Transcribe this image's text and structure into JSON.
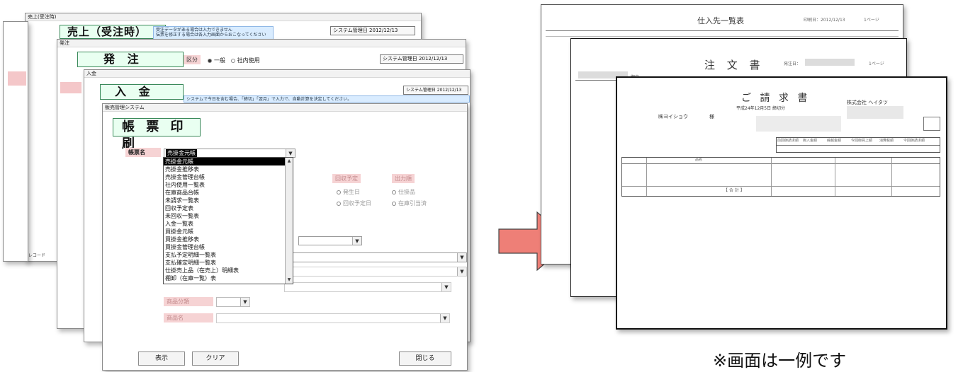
{
  "windows": {
    "sales": {
      "title": "売上(受注時)",
      "heading": "売上（受注時）",
      "note_line1": "受注データがある場合は入力できません",
      "note_line2": "伝票を修正する場合は各入力画面からおこなってください",
      "system_date_label": "システム管理日",
      "system_date": "2012/12/13",
      "footer": "レコード"
    },
    "order": {
      "title": "発注",
      "heading": "発 注",
      "kubun_label": "区分",
      "radio_ippan": "一般",
      "radio_shanai": "社内使用",
      "system_date_label": "システム管理日",
      "system_date": "2012/12/13"
    },
    "payment": {
      "title": "入金",
      "heading": "入 金",
      "system_date_label": "システム管理日",
      "system_date": "2012/12/13",
      "note": "システムで今日を含む場合、「締切」「翌月」で入力で、自動計算を決定してください。"
    },
    "report": {
      "title": "販売管理システム",
      "heading": "帳 票 印 刷",
      "report_name_label": "帳票名",
      "selected_value": "売掛金元帳",
      "list_items": [
        "売掛金元帳",
        "売掛金推移表",
        "売掛金管理台帳",
        "社内使用一覧表",
        "在庫商品台帳",
        "未請求一覧表",
        "回収予定表",
        "未回収一覧表",
        "入金一覧表",
        "買掛金元帳",
        "買掛金推移表",
        "買掛金管理台帳",
        "支払予定明細一覧表",
        "支払確定明細一覧表",
        "仕掛売上品（在売上）明細表",
        "棚卸（在庫一覧）表"
      ],
      "group1_label": "回収予定",
      "group1_opt1": "発生日",
      "group1_opt2": "回収予定日",
      "group2_label": "出力順",
      "group2_opt1": "仕掛品",
      "group2_opt2": "在庫引当済",
      "category_label": "商品分類",
      "product_label": "商品名",
      "btn_display": "表示",
      "btn_clear": "クリア",
      "btn_close": "閉じる"
    }
  },
  "documents": {
    "supplier_list": {
      "title": "仕入先一覧表",
      "print_date": "印刷日：2012/12/13",
      "page": "1ページ"
    },
    "purchase_order": {
      "title": "注 文 書",
      "order_date_label": "発注日：",
      "page": "1ページ",
      "recipient": "御中"
    },
    "invoice": {
      "title": "ご 請 求 書",
      "subtitle": "平成24年12月5日 締切分",
      "customer": "㈱ヨイショウ",
      "honorific": "様",
      "company": "株式会社 ヘイタツ",
      "col_prev": "前回御請求額",
      "col_received": "御入金額",
      "col_carry": "繰越金額",
      "col_sales": "今回御買上額",
      "col_tax": "消費税額",
      "col_total": "今回御請求額",
      "row_label": "品名",
      "total_label": "【 合 計 】"
    }
  },
  "caption": "※画面は一例です",
  "colors": {
    "arrow": "#ee7f77",
    "heading_bg": "#e9fff1",
    "note_bg": "#d9ecff",
    "label_pink": "#f6d3d4"
  }
}
